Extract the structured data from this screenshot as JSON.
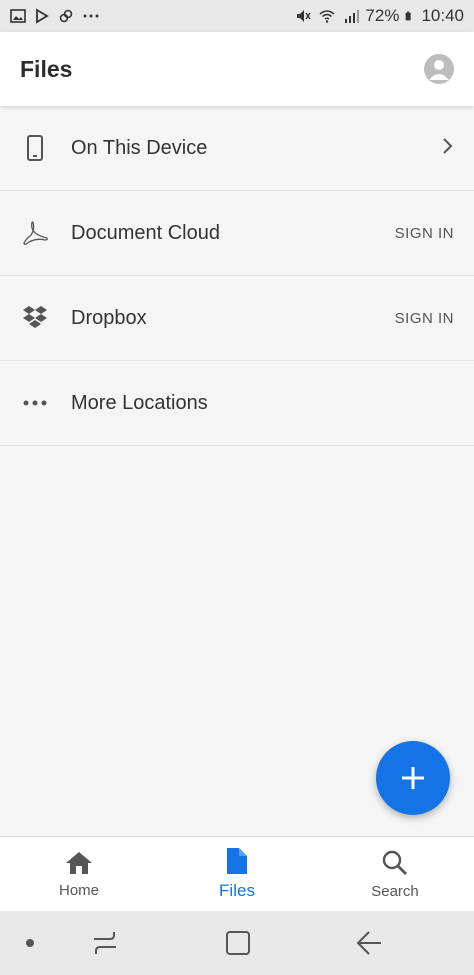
{
  "status_bar": {
    "battery": "72%",
    "time": "10:40"
  },
  "header": {
    "title": "Files"
  },
  "locations": [
    {
      "label": "On This Device",
      "icon": "phone-icon",
      "action": ""
    },
    {
      "label": "Document Cloud",
      "icon": "acrobat-icon",
      "action": "SIGN IN"
    },
    {
      "label": "Dropbox",
      "icon": "dropbox-icon",
      "action": "SIGN IN"
    },
    {
      "label": "More Locations",
      "icon": "more-dots-icon",
      "action": ""
    }
  ],
  "bottom_nav": {
    "home": "Home",
    "files": "Files",
    "search": "Search"
  },
  "colors": {
    "accent": "#1473e6",
    "background": "#f5f5f5"
  }
}
